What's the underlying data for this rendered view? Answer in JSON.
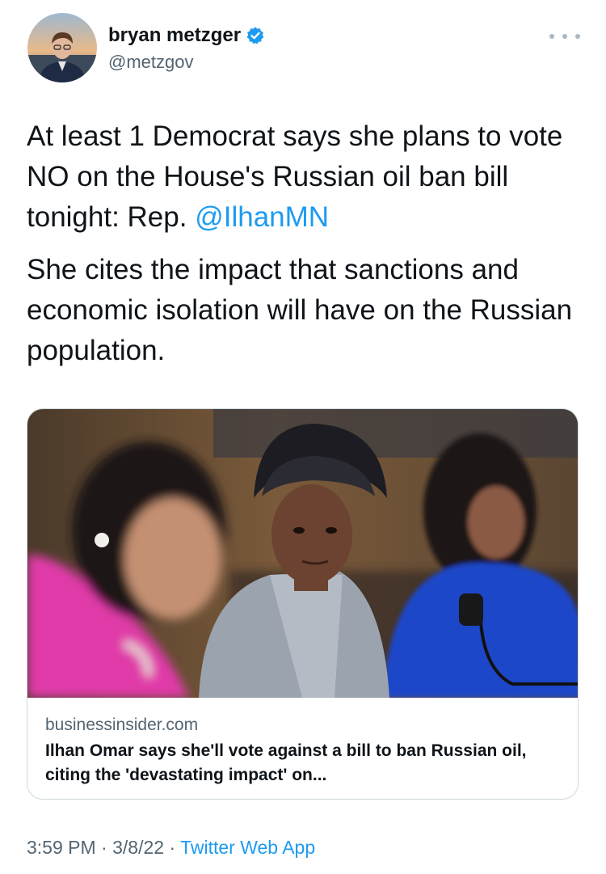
{
  "author": {
    "name": "bryan metzger",
    "handle": "@metzgov",
    "verified": true,
    "avatar_icon": "profile-photo"
  },
  "menu_icon": "more-dots-icon",
  "tweet": {
    "line1_text": "At least 1 Democrat says she plans to vote NO on the House's Russian oil ban bill tonight: Rep. ",
    "mention": "@IlhanMN",
    "paragraph2": "She cites the impact that sanctions and economic isolation will have on the Russian population."
  },
  "link_card": {
    "domain": "businessinsider.com",
    "headline": "Ilhan Omar says she'll vote against a bill to ban Russian oil, citing the 'devastating impact' on..."
  },
  "meta": {
    "time": "3:59 PM",
    "separator": " · ",
    "date": "3/8/22",
    "source": "Twitter Web App"
  },
  "colors": {
    "accent": "#1d9bf0",
    "text": "#0f1419",
    "secondary": "#536471"
  }
}
